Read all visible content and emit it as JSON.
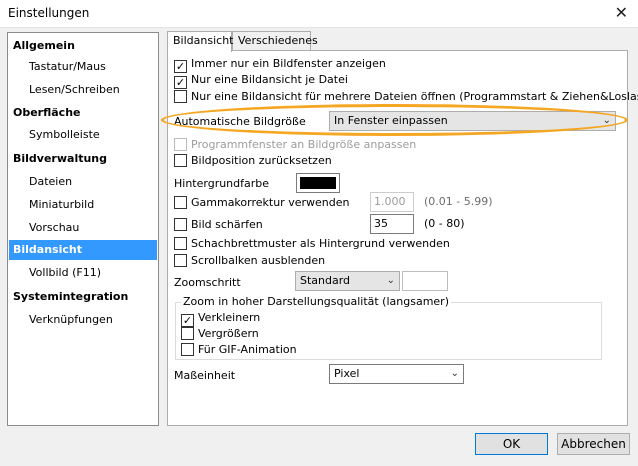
{
  "window": {
    "title": "Einstellungen",
    "close_glyph": "✕"
  },
  "nav": {
    "items": [
      {
        "label": "Allgemein",
        "type": "cat",
        "name": "nav-allgemein"
      },
      {
        "label": "Tastatur/Maus",
        "type": "sub",
        "name": "nav-tastatur-maus"
      },
      {
        "label": "Lesen/Schreiben",
        "type": "sub",
        "name": "nav-lesen-schreiben"
      },
      {
        "label": "Oberfläche",
        "type": "cat",
        "name": "nav-oberflaeche"
      },
      {
        "label": "Symbolleiste",
        "type": "sub",
        "name": "nav-symbolleiste"
      },
      {
        "label": "Bildverwaltung",
        "type": "cat",
        "name": "nav-bildverwaltung"
      },
      {
        "label": "Dateien",
        "type": "sub",
        "name": "nav-dateien"
      },
      {
        "label": "Miniaturbild",
        "type": "sub",
        "name": "nav-miniaturbild"
      },
      {
        "label": "Vorschau",
        "type": "sub",
        "name": "nav-vorschau"
      },
      {
        "label": "Bildansicht",
        "type": "cat",
        "name": "nav-bildansicht",
        "selected": true
      },
      {
        "label": "Vollbild  (F11)",
        "type": "sub",
        "name": "nav-vollbild"
      },
      {
        "label": "Systemintegration",
        "type": "cat",
        "name": "nav-systemintegration"
      },
      {
        "label": "Verknüpfungen",
        "type": "sub",
        "name": "nav-verknuepfungen"
      }
    ]
  },
  "tabs": {
    "bildansicht": "Bildansicht",
    "verschiedenes": "Verschiedenes"
  },
  "options": {
    "immer_nur_ein_fenster": {
      "label": "Immer nur ein Bildfenster anzeigen",
      "checked": true
    },
    "nur_eine_ansicht_je_datei": {
      "label": "Nur eine Bildansicht je Datei",
      "checked": true
    },
    "nur_eine_ansicht_mehrere": {
      "label": "Nur eine Bildansicht für mehrere Dateien öffnen (Programmstart & Ziehen&Loslassen)",
      "checked": false
    },
    "auto_bildgroesse_label": "Automatische Bildgröße",
    "auto_bildgroesse_value": "In Fenster einpassen",
    "programmfenster_anpassen": {
      "label": "Programmfenster an Bildgröße anpassen",
      "checked": false
    },
    "bildposition_zuruecksetzen": {
      "label": "Bildposition zurücksetzen",
      "checked": false
    },
    "hintergrundfarbe_label": "Hintergrundfarbe",
    "gammakorrektur": {
      "label": "Gammakorrektur verwenden",
      "checked": false,
      "value": "1.000",
      "hint": "(0.01 - 5.99)"
    },
    "bild_schaerfen": {
      "label": "Bild schärfen",
      "checked": false,
      "value": "35",
      "hint": "(0 - 80)"
    },
    "schachbrettmuster": {
      "label": "Schachbrettmuster als Hintergrund verwenden",
      "checked": false
    },
    "scrollbalken": {
      "label": "Scrollbalken ausblenden",
      "checked": false
    },
    "zoomschritt_label": "Zoomschritt",
    "zoomschritt_value": "Standard",
    "zoom_group_title": "Zoom in hoher Darstellungsqualität (langsamer)",
    "verkleinern": {
      "label": "Verkleinern",
      "checked": true
    },
    "vergroessern": {
      "label": "Vergrößern",
      "checked": false
    },
    "gif_animation": {
      "label": "Für GIF-Animation",
      "checked": false
    },
    "masseinheit_label": "Maßeinheit",
    "masseinheit_value": "Pixel"
  },
  "buttons": {
    "ok": "OK",
    "abbrechen": "Abbrechen"
  },
  "colors": {
    "selection": "#3399ff",
    "highlight_ring": "#f5a623",
    "background_color_swatch": "#000000"
  },
  "glyphs": {
    "check": "✓",
    "chevron": "⌄"
  }
}
